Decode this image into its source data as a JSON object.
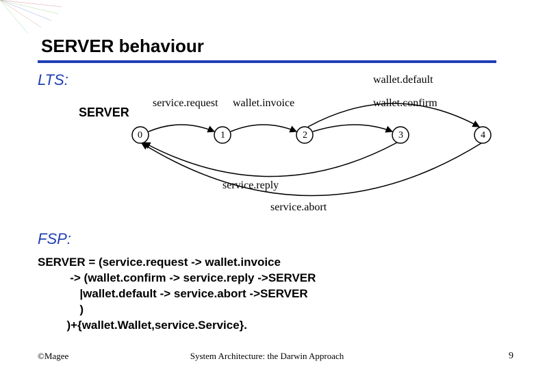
{
  "title": "SERVER behaviour",
  "sections": {
    "lts": "LTS:",
    "fsp": "FSP:"
  },
  "lts_diagram": {
    "process_name": "SERVER",
    "states": [
      "0",
      "1",
      "2",
      "3",
      "4"
    ],
    "edges": {
      "e01": "service.request",
      "e12": "wallet.invoice",
      "e23": "wallet.confirm",
      "e24_top": "wallet.default",
      "e30_reply": "service.reply",
      "e40_abort": "service.abort"
    }
  },
  "fsp_code": "SERVER = (service.request -> wallet.invoice\n          -> (wallet.confirm -> service.reply ->SERVER\n             |wallet.default -> service.abort ->SERVER\n             )\n         )+{wallet.Wallet,service.Service}.",
  "footer": {
    "left": "©Magee",
    "center": "System Architecture: the Darwin Approach",
    "right": "9"
  }
}
